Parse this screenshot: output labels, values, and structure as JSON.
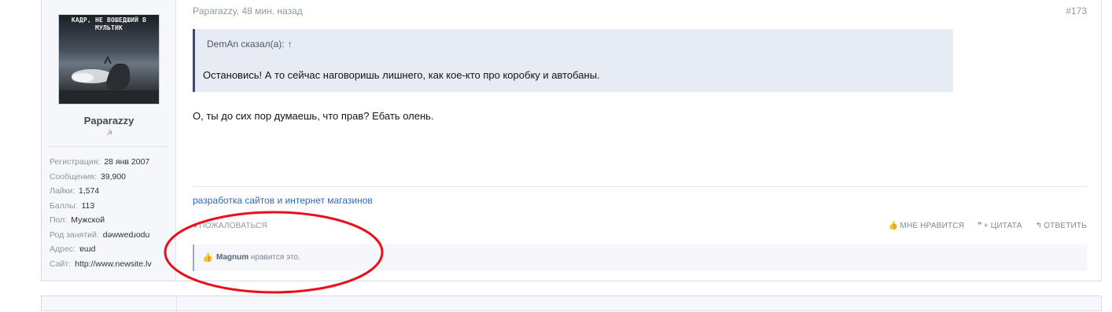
{
  "user": {
    "avatar_caption": "КАДР, НЕ ВОШЕДШИЙ В МУЛЬТИК",
    "username": "Paparazzy",
    "title_icon": "hammer-sickle-icon",
    "info": [
      {
        "key": "Регистрация:",
        "value": "28 янв 2007"
      },
      {
        "key": "Сообщения:",
        "value": "39,900"
      },
      {
        "key": "Лайки:",
        "value": "1,574"
      },
      {
        "key": "Баллы:",
        "value": "113"
      },
      {
        "key": "Пол:",
        "value": "Мужской"
      },
      {
        "key": "Род занятий:",
        "value": "dəwwedɹodu"
      },
      {
        "key": "Адрес:",
        "value": "ɐɯd"
      },
      {
        "key": "Сайт:",
        "value": "http://www.newsite.lv"
      }
    ]
  },
  "post": {
    "meta": "Paparazzy, 48 мин. назад",
    "number": "#173",
    "quote": {
      "author": "DemAn сказал(а):",
      "arrow": "↑",
      "text": "Остановись! А то сейчас наговоришь лишнего, как кое-кто про коробку и автобаны."
    },
    "message": "О, ты до сих пор думаешь, что прав? Ебать олень.",
    "signature": "разработка сайтов и интернет магазинов",
    "report_label": "ПОЖАЛОВАТЬСЯ",
    "actions": {
      "like": "МНЕ НРАВИТСЯ",
      "quote": "+ ЦИТАТА",
      "reply": "ОТВЕТИТЬ"
    },
    "likes": {
      "user": "Magnum",
      "suffix": " нравится это."
    }
  },
  "colors": {
    "accent": "#3a4b77",
    "link": "#2e6ab8",
    "annotation": "#e8101a"
  }
}
